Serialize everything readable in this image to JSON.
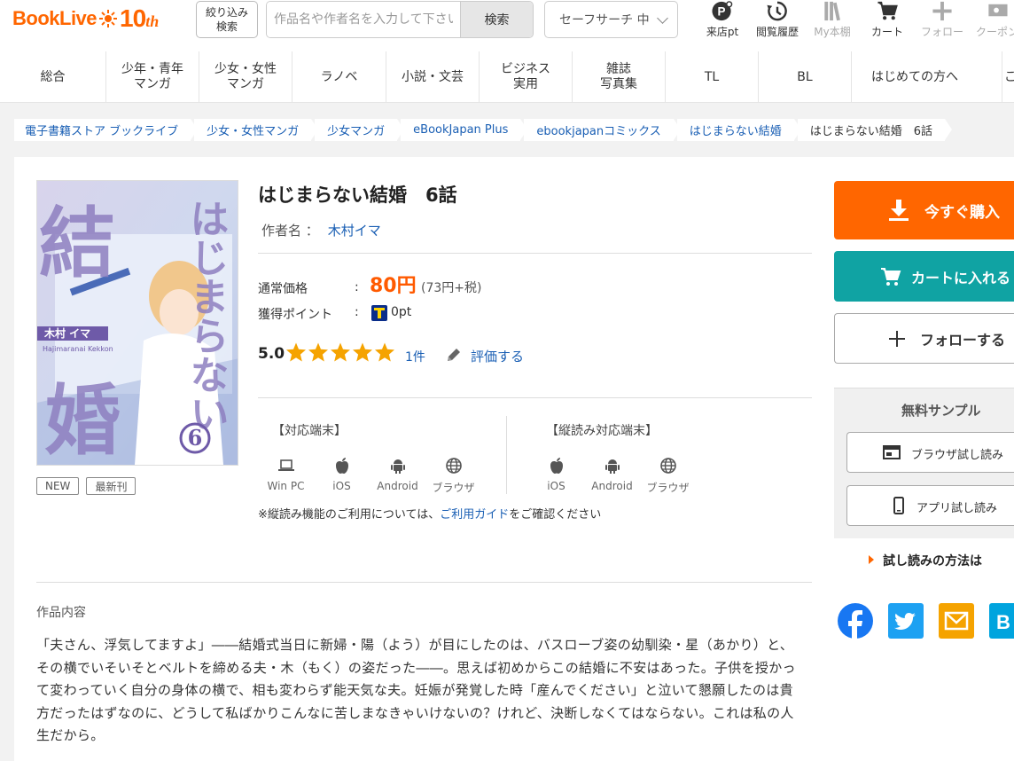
{
  "header": {
    "logo_text": "BookLive",
    "logo_10": "10",
    "logo_th": "th",
    "filter_label_1": "絞り込み",
    "filter_label_2": "検索",
    "search_placeholder": "作品名や作者名を入力して下さい",
    "search_button": "検索",
    "safe_search": "セーフサーチ 中",
    "icons": [
      {
        "name": "points-icon",
        "label": "来店pt"
      },
      {
        "name": "history-icon",
        "label": "閲覧履歴"
      },
      {
        "name": "bookshelf-icon",
        "label": "My本棚"
      },
      {
        "name": "cart-icon",
        "label": "カート"
      },
      {
        "name": "follow-icon",
        "label": "フォロー"
      },
      {
        "name": "coupon-icon",
        "label": "クーポン"
      }
    ]
  },
  "catnav": [
    {
      "line1": "総合",
      "line2": ""
    },
    {
      "line1": "少年・青年",
      "line2": "マンガ"
    },
    {
      "line1": "少女・女性",
      "line2": "マンガ"
    },
    {
      "line1": "ラノベ",
      "line2": ""
    },
    {
      "line1": "小説・文芸",
      "line2": ""
    },
    {
      "line1": "ビジネス",
      "line2": "実用"
    },
    {
      "line1": "雑誌",
      "line2": "写真集"
    },
    {
      "line1": "TL",
      "line2": ""
    },
    {
      "line1": "BL",
      "line2": ""
    }
  ],
  "catnav_firsttime": "はじめての方へ",
  "catnav_more": "こ",
  "breadcrumb": [
    "電子書籍ストア ブックライブ",
    "少女・女性マンガ",
    "少女マンガ",
    "eBookJapan Plus",
    "ebookjapanコミックス",
    "はじまらない結婚",
    "はじまらない結婚　6話"
  ],
  "book": {
    "title": "はじまらない結婚　6話",
    "author_label": "作者名 ：",
    "author": "木村イマ",
    "tags": [
      "NEW",
      "最新刊"
    ],
    "price_label": "通常価格",
    "price": "80円",
    "price_tax": "(73円+税)",
    "point_label": "獲得ポイント",
    "point_value": "0pt",
    "rating": "5.0",
    "rating_stars": 5,
    "rating_count": "1件",
    "review_link": "評価する",
    "cover_title_1": "結",
    "cover_title_2": "婚",
    "cover_title_right": "はじまらない",
    "cover_author": "木村 イマ",
    "cover_volume": "6",
    "cover_sub": "Hajimaranai Kekkon"
  },
  "devices": {
    "head": "【対応端末】",
    "items": [
      "Win PC",
      "iOS",
      "Android",
      "ブラウザ"
    ],
    "vertical_head": "【縦読み対応端末】",
    "vertical_items": [
      "iOS",
      "Android",
      "ブラウザ"
    ],
    "note_prefix": "※縦読み機能のご利用については、",
    "note_link": "ご利用ガイド",
    "note_suffix": "をご確認ください"
  },
  "description": {
    "title": "作品内容",
    "text": "「夫さん、浮気してますよ」――結婚式当日に新婦・陽（よう）が目にしたのは、バスローブ姿の幼馴染・星（あかり）と、その横でいそいそとベルトを締める夫・木（もく）の姿だった――。思えば初めからこの結婚に不安はあった。子供を授かって変わっていく自分の身体の横で、相も変わらず能天気な夫。妊娠が発覚した時「産んでください」と泣いて懇願したのは貴方だったはずなのに、どうして私ばかりこんなに苦しまなきゃいけないの？けれど、決断しなくてはならない。これは私の人生だから。"
  },
  "actions": {
    "buy": "今すぐ購入",
    "cart": "カートに入れる",
    "follow": "フォローする",
    "sample_title": "無料サンプル",
    "browser_sample": "ブラウザ試し読み",
    "app_sample": "アプリ試し読み",
    "howto": "試し読みの方法は"
  },
  "colors": {
    "brand": "#ff6600",
    "cart": "#10a3a3",
    "link": "#1a5fb4",
    "star": "#f5a300"
  }
}
